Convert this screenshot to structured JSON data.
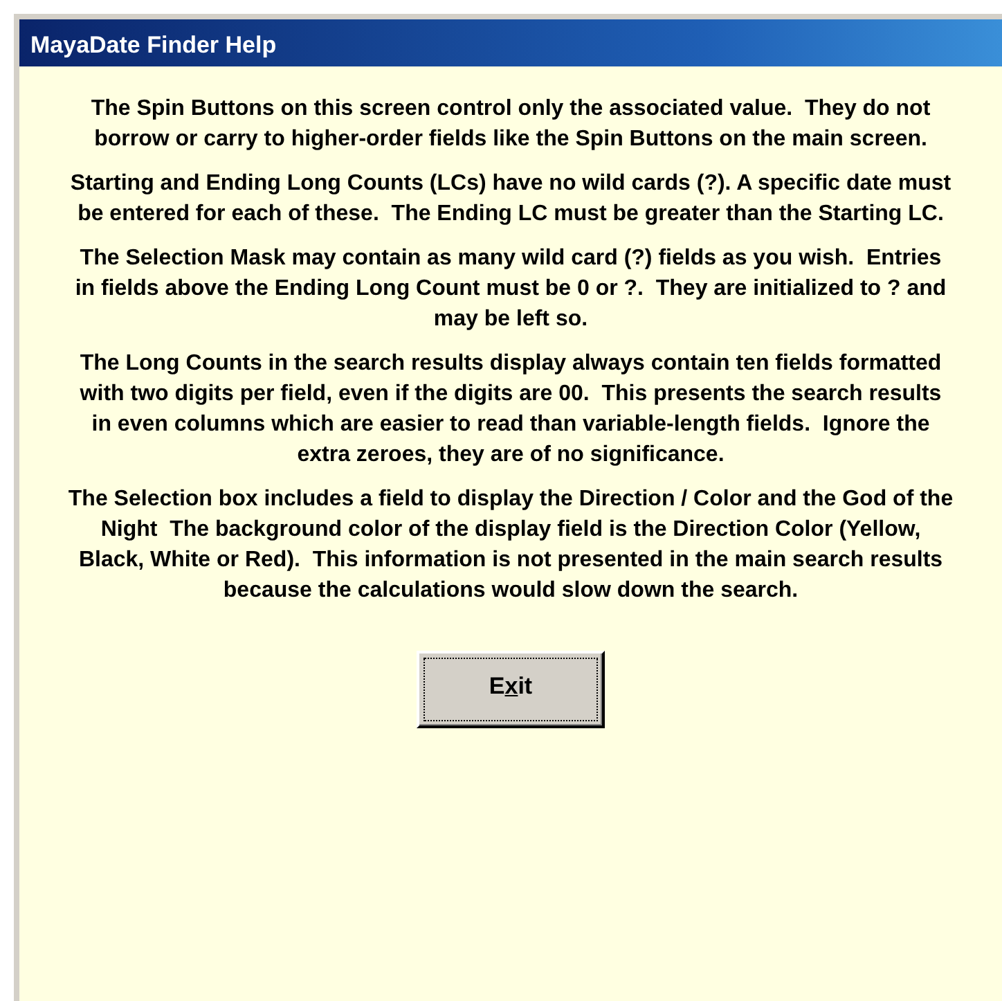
{
  "window": {
    "title": "MayaDate Finder Help"
  },
  "paragraphs": [
    "The Spin Buttons on this screen control only the associated value.  They do not borrow or carry to higher-order fields like the Spin Buttons on the main screen.",
    "Starting and Ending Long Counts (LCs) have no wild cards (?). A specific date must be entered for each of these.  The Ending LC must be greater than the Starting LC.",
    "The Selection Mask may contain as many wild card (?) fields as you wish.  Entries in fields above the Ending Long Count must be 0 or ?.  They are initialized to ? and may be left so.",
    "The Long Counts in the search results display always contain ten fields formatted with two digits per field, even if the digits are 00.  This presents the search results in even columns which are easier to read than variable-length fields.  Ignore the extra zeroes, they are of no significance.",
    "The Selection box includes a field to display the Direction / Color and the God of the Night  The background color of the display field is the Direction Color (Yellow, Black, White or Red).  This information is not presented in the main search results because the calculations would slow down the search."
  ],
  "button": {
    "label_before": "E",
    "access_key": "x",
    "label_after": "it",
    "focused": true
  }
}
